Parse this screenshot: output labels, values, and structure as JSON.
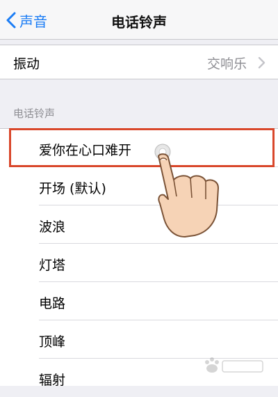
{
  "navbar": {
    "back_label": "声音",
    "title": "电话铃声"
  },
  "vibration": {
    "label": "振动",
    "value": "交响乐"
  },
  "ringtones": {
    "header": "电话铃声",
    "items": [
      {
        "label": "爱你在心口难开"
      },
      {
        "label": "开场 (默认)"
      },
      {
        "label": "波浪"
      },
      {
        "label": "灯塔"
      },
      {
        "label": "电路"
      },
      {
        "label": "顶峰"
      },
      {
        "label": "辐射"
      }
    ]
  },
  "colors": {
    "accent": "#1a7cf5",
    "highlight": "#d9472b",
    "background": "#efeff4"
  }
}
